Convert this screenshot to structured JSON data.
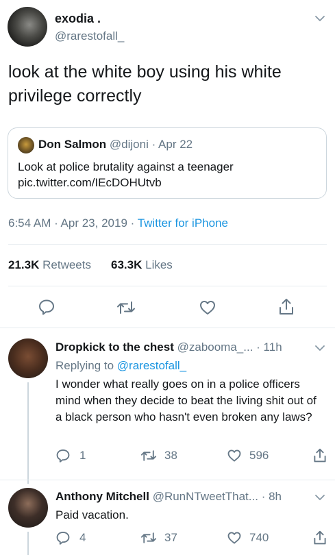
{
  "main_tweet": {
    "display_name": "exodia .",
    "handle": "@rarestofall_",
    "text": "look at the white boy using his white privilege correctly",
    "quoted": {
      "display_name": "Don Salmon",
      "handle": "@dijoni",
      "date": "· Apr 22",
      "text": "Look at police brutality against a teenager",
      "link": "pic.twitter.com/IEcDOHUtvb"
    },
    "timestamp": "6:54 AM · Apr 23, 2019 · ",
    "source": "Twitter for iPhone",
    "retweets_count": "21.3K",
    "retweets_label": "Retweets",
    "likes_count": "63.3K",
    "likes_label": "Likes"
  },
  "replies": [
    {
      "display_name": "Dropkick to the chest",
      "handle": "@zabooma_...",
      "time": "· 11h",
      "replying_prefix": "Replying to ",
      "replying_handle": "@rarestofall_",
      "text": "I wonder what really goes on in a police officers mind when they decide to beat the living shit out of a black person who hasn't even broken any laws?",
      "reply_count": "1",
      "retweet_count": "38",
      "like_count": "596"
    },
    {
      "display_name": "Anthony Mitchell",
      "handle": "@RunNTweetThat...",
      "time": "· 8h",
      "text": "Paid vacation.",
      "reply_count": "4",
      "retweet_count": "37",
      "like_count": "740"
    }
  ],
  "icons": [
    "chevron-down-icon",
    "reply-icon",
    "retweet-icon",
    "like-icon",
    "share-icon"
  ],
  "colors": {
    "link": "#1b95e0",
    "text": "#14171a",
    "secondary": "#657786",
    "divider": "#e6ecf0"
  }
}
